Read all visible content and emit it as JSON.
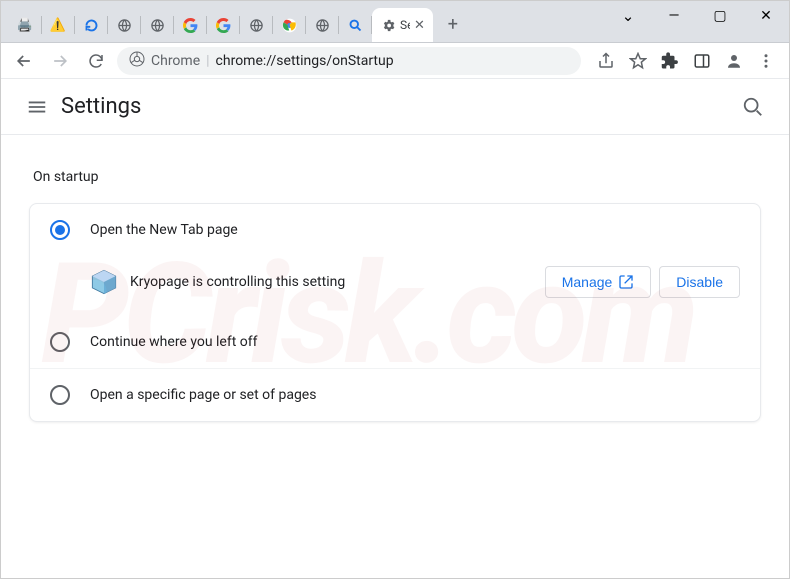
{
  "window": {
    "tabs_overflow_chevron": "⌄",
    "active_tab_title": "Settings - On startup",
    "new_tab_label": "+",
    "minimize": "—",
    "maximize": "▢",
    "close": "✕"
  },
  "addressbar": {
    "chip_icon_label": "Chrome",
    "chip_text": "Chrome",
    "url": "chrome://settings/onStartup"
  },
  "header": {
    "title": "Settings"
  },
  "settings": {
    "section_title": "On startup",
    "option_new_tab": "Open the New Tab page",
    "option_continue": "Continue where you left off",
    "option_specific": "Open a specific page or set of pages",
    "extension_notice": "Kryopage is controlling this setting",
    "manage_label": "Manage",
    "disable_label": "Disable",
    "selected": "new_tab"
  },
  "watermark": "PCrisk.com"
}
